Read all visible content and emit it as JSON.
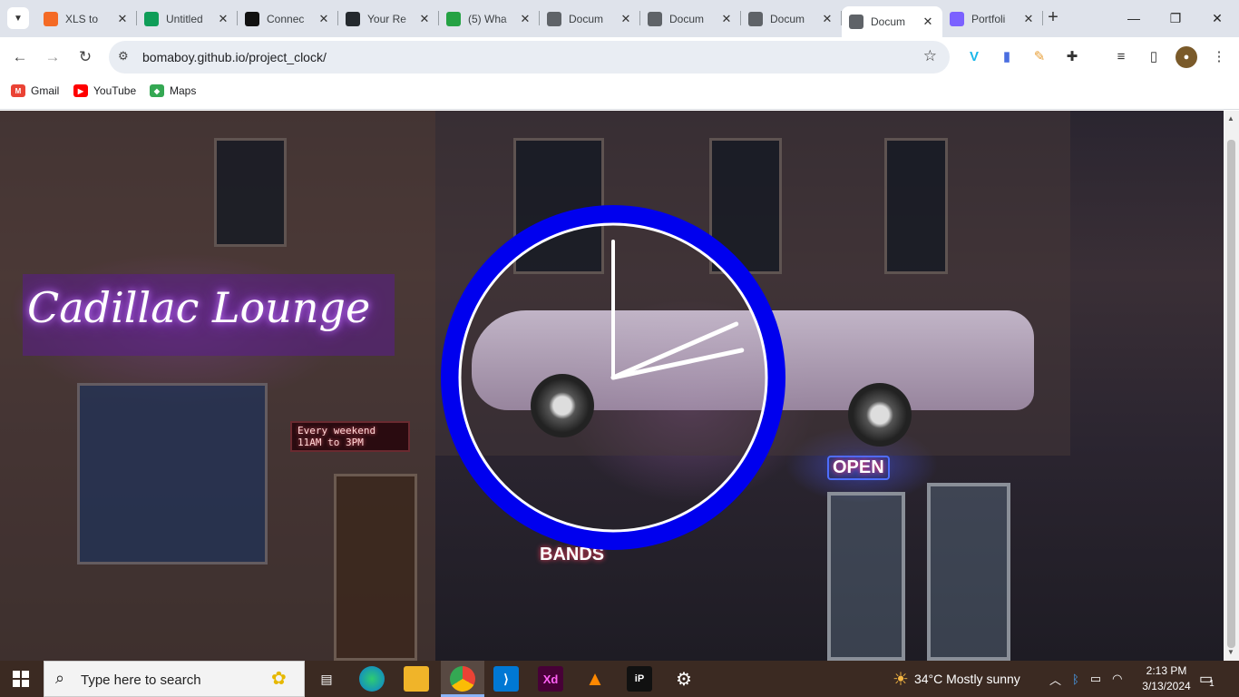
{
  "browser": {
    "tabs": [
      {
        "title": "XLS to",
        "color": "#f46a25",
        "icon": "xls-icon"
      },
      {
        "title": "Untitled",
        "color": "#0f9d58",
        "icon": "sheets-icon"
      },
      {
        "title": "Connec",
        "color": "#111111",
        "icon": "medium-icon"
      },
      {
        "title": "Your Re",
        "color": "#24292e",
        "icon": "github-icon"
      },
      {
        "title": "(5) Wha",
        "color": "#25a244",
        "icon": "whatsapp-icon"
      },
      {
        "title": "Docum",
        "color": "#5f6368",
        "icon": "globe-icon"
      },
      {
        "title": "Docum",
        "color": "#5f6368",
        "icon": "globe-icon"
      },
      {
        "title": "Docum",
        "color": "#5f6368",
        "icon": "globe-icon"
      },
      {
        "title": "Docum",
        "color": "#5f6368",
        "icon": "globe-icon",
        "active": true
      },
      {
        "title": "Portfoli",
        "color": "#7b61ff",
        "icon": "vercel-icon"
      }
    ],
    "url": "bomaboy.github.io/project_clock/",
    "bookmarks": [
      {
        "label": "Gmail",
        "icon": "gmail-icon"
      },
      {
        "label": "YouTube",
        "icon": "youtube-icon"
      },
      {
        "label": "Maps",
        "icon": "maps-icon"
      }
    ]
  },
  "page": {
    "led_sign": "Every weekend\n11AM to 3PM",
    "open_sign": "OPEN",
    "bands_sign": "BANDS",
    "neon_sign": "Cadillac Lounge",
    "clock": {
      "ring_color": "#0000ee",
      "hand_color": "#ffffff",
      "hour": 2,
      "minute": 13,
      "second": 0
    }
  },
  "taskbar": {
    "search_placeholder": "Type here to search",
    "weather": "34°C  Mostly sunny",
    "time": "2:13 PM",
    "date": "3/13/2024",
    "notification_count": "1"
  }
}
